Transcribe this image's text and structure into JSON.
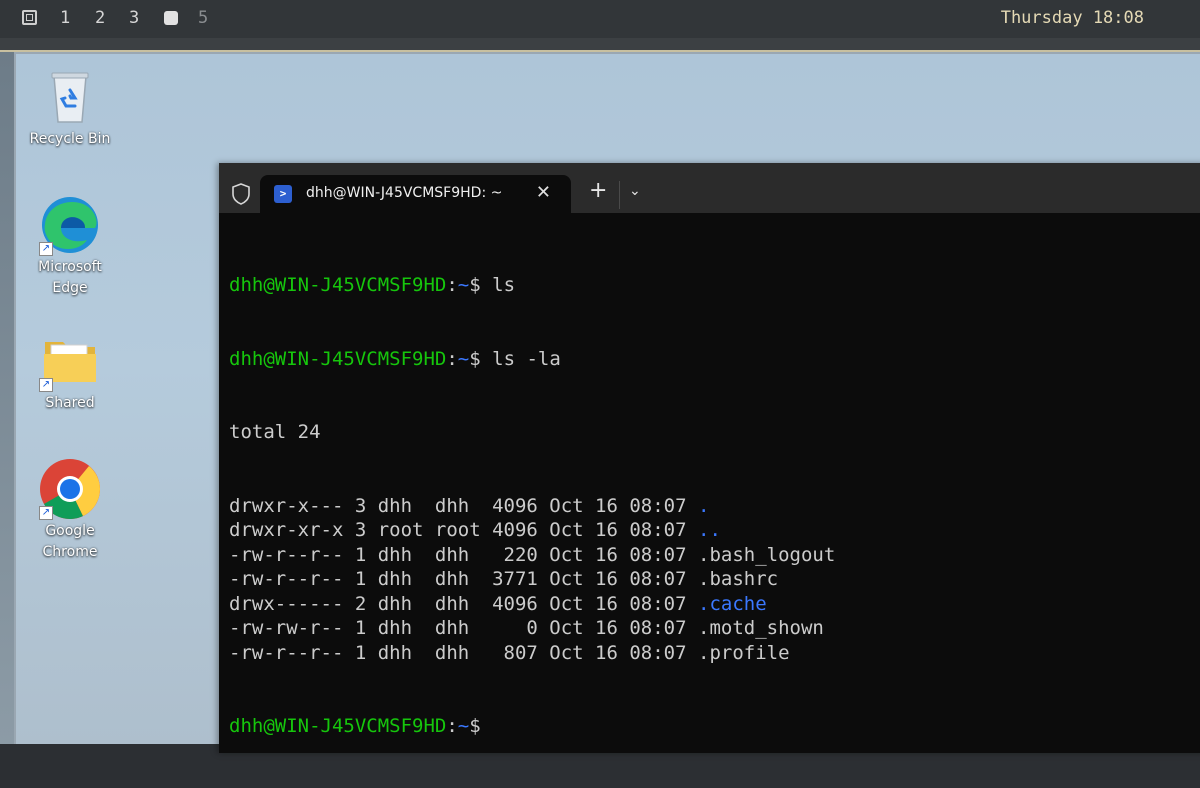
{
  "topbar": {
    "workspaces": [
      "1",
      "2",
      "3",
      "5"
    ],
    "clock": "Thursday 18:08"
  },
  "desktop_icons": [
    {
      "label": "Recycle Bin",
      "icon": "recycle-bin-icon"
    },
    {
      "label_line1": "Microsoft",
      "label_line2": "Edge",
      "icon": "edge-icon"
    },
    {
      "label": "Shared",
      "icon": "folder-icon"
    },
    {
      "label_line1": "Google",
      "label_line2": "Chrome",
      "icon": "chrome-icon"
    }
  ],
  "terminal": {
    "tab_title": "dhh@WIN-J45VCMSF9HD: ~",
    "prompt_user": "dhh@WIN-J45VCMSF9HD",
    "prompt_sep": ":",
    "prompt_path": "~",
    "prompt_dollar": "$",
    "commands": [
      " ls",
      " ls -la"
    ],
    "total": "total 24",
    "listing": [
      {
        "meta": "drwxr-x--- 3 dhh  dhh  4096 Oct 16 08:07 ",
        "name": ".",
        "color": "#3b78ff"
      },
      {
        "meta": "drwxr-xr-x 3 root root 4096 Oct 16 08:07 ",
        "name": "..",
        "color": "#3b78ff"
      },
      {
        "meta": "-rw-r--r-- 1 dhh  dhh   220 Oct 16 08:07 ",
        "name": ".bash_logout",
        "color": "#cccccc"
      },
      {
        "meta": "-rw-r--r-- 1 dhh  dhh  3771 Oct 16 08:07 ",
        "name": ".bashrc",
        "color": "#cccccc"
      },
      {
        "meta": "drwx------ 2 dhh  dhh  4096 Oct 16 08:07 ",
        "name": ".cache",
        "color": "#3b78ff"
      },
      {
        "meta": "-rw-rw-r-- 1 dhh  dhh     0 Oct 16 08:07 ",
        "name": ".motd_shown",
        "color": "#cccccc"
      },
      {
        "meta": "-rw-r--r-- 1 dhh  dhh   807 Oct 16 08:07 ",
        "name": ".profile",
        "color": "#cccccc"
      }
    ]
  }
}
